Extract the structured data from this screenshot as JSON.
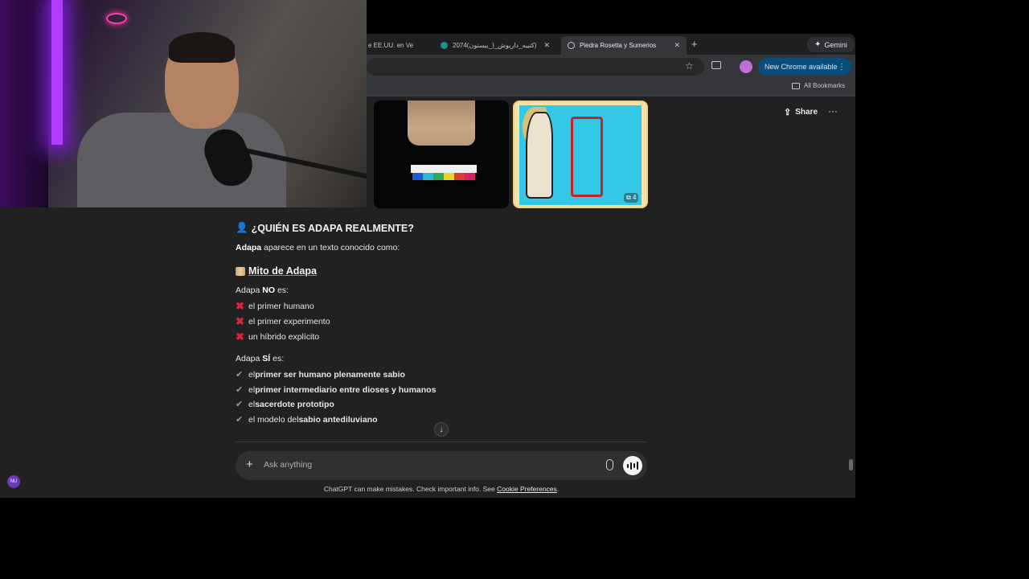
{
  "browser": {
    "tabs": [
      {
        "label": "e EE.UU. en Ve",
        "active": false
      },
      {
        "label": "كتيبه_داريوش_(_بيستون)2074)",
        "active": false
      },
      {
        "label": "Piedra Rosetta y Sumerios",
        "active": true
      }
    ],
    "gemini_label": "Gemini",
    "update_label": "New Chrome available",
    "all_bookmarks": "All Bookmarks",
    "profile_initial": "",
    "colors": {
      "update_bg": "#0a4c7a",
      "tab_active": "#35363a"
    }
  },
  "header": {
    "share_label": "Share"
  },
  "images": {
    "count_badge": "4"
  },
  "content": {
    "heading1": "¿QUIÉN ES ADAPA REALMENTE?",
    "intro_bold": "Adapa",
    "intro_rest": " aparece en un texto conocido como:",
    "heading2": "Mito de Adapa",
    "no_label_pre": "Adapa ",
    "no_label_bold": "NO",
    "no_label_post": " es:",
    "no_items": [
      "el primer humano",
      "el primer experimento",
      "un híbrido explícito"
    ],
    "si_label_pre": "Adapa ",
    "si_label_bold": "SÍ",
    "si_label_post": " es:",
    "si_items": [
      {
        "pre": "el ",
        "bold": "primer ser humano plenamente sabio",
        "post": ""
      },
      {
        "pre": "el ",
        "bold": "primer intermediario entre dioses y humanos",
        "post": ""
      },
      {
        "pre": "el ",
        "bold": "sacerdote prototipo",
        "post": ""
      },
      {
        "pre": "el modelo del ",
        "bold": "sabio antediluviano",
        "post": ""
      }
    ]
  },
  "composer": {
    "placeholder": "Ask anything"
  },
  "footer": {
    "note": "ChatGPT can make mistakes. Check important info. See ",
    "link": "Cookie Preferences",
    "end": "."
  },
  "user": {
    "initials": "NU"
  }
}
